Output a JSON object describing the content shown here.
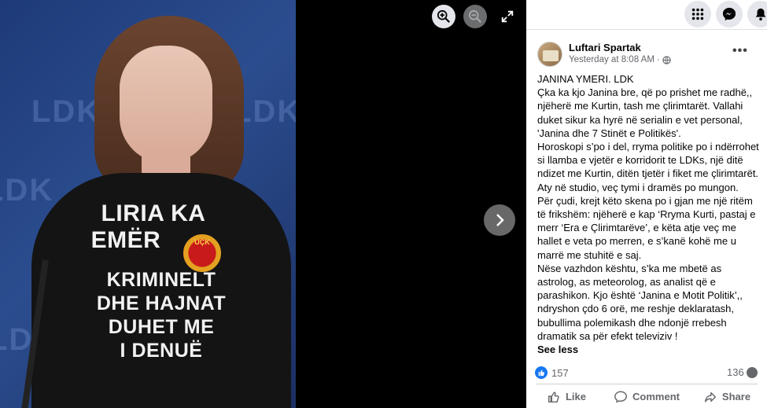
{
  "photo": {
    "background_text": "LDK",
    "shirt_lines": [
      "LIRIA KA",
      "EMËR",
      "KRIMINELT",
      "DHE HAJNAT",
      "DUHET ME",
      "I DENUË"
    ],
    "badge_text": "UÇK"
  },
  "viewer_controls": {
    "zoom_in_icon": "zoom-in-icon",
    "zoom_out_icon": "zoom-out-icon",
    "expand_icon": "expand-icon",
    "next_icon": "chevron-right-icon"
  },
  "topbar": {
    "menu_icon": "grid-menu-icon",
    "messenger_icon": "messenger-icon",
    "notifications_icon": "bell-icon"
  },
  "post": {
    "author": "Luftari Spartak",
    "timestamp": "Yesterday at 8:08 AM",
    "separator": "·",
    "paragraphs": [
      "JANINA YMERI. LDK",
      "Çka ka kjo Janina bre, që po prishet me radhë,, njëherë me Kurtin, tash me çlirimtarët. Vallahi duket sikur ka hyrë në serialin e vet personal, 'Janina dhe 7 Stinët e Politikës'.",
      "Horoskopi s’po i del, rryma politike po i ndërrohet si llamba e vjetër e korridorit te LDKs, një ditë ndizet me Kurtin, ditën tjetër i fiket me çlirimtarët. Aty në studio, veç tymi i dramës po mungon.",
      "Për çudi, krejt këto skena po i gjan me një ritëm të frikshëm: njëherë e kap ‘Rryma Kurti, pastaj e merr ‘Era e Çlirimtarëve’, e këta atje veç me hallet e veta po merren, e s’kanë kohë me u marrë me stuhitë e saj.",
      "Nëse vazhdon kështu, s’ka me mbetë as astrolog, as meteorolog, as analist që e parashikon. Kjo është ‘Janina e Motit Politik’,, ndryshon çdo 6 orë, me reshje deklaratash, bubullima polemikash dhe ndonjë rrebesh dramatik sa për efekt televiziv !"
    ],
    "see_less": "See less"
  },
  "stats": {
    "reactions": "157",
    "comments": "136"
  },
  "actions": {
    "like": "Like",
    "comment": "Comment",
    "share": "Share"
  },
  "colors": {
    "accent": "#1877f2",
    "secondary_text": "#65676b"
  }
}
